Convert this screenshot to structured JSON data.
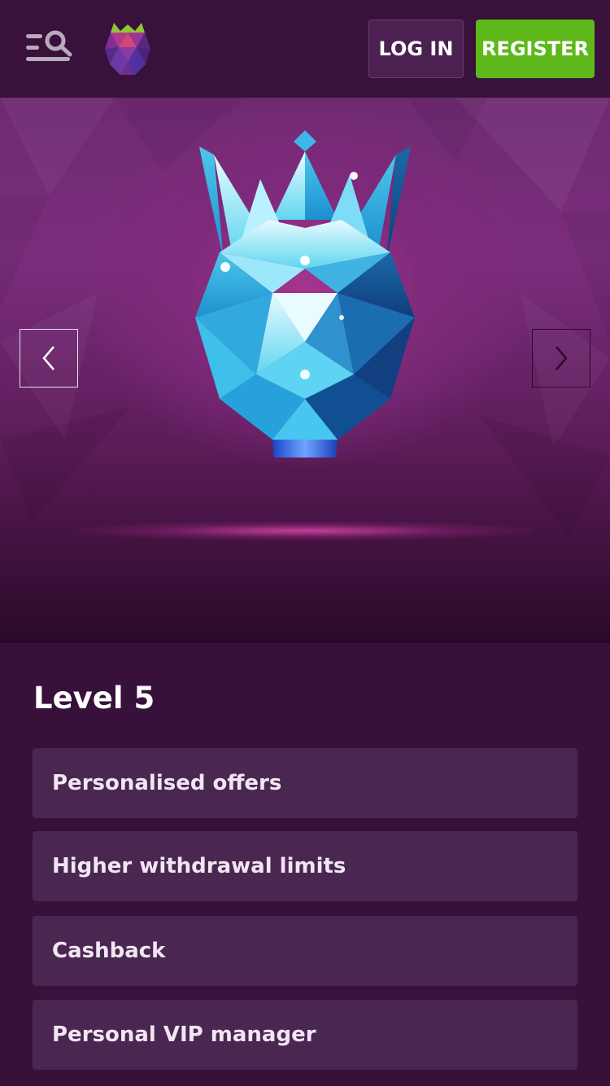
{
  "header": {
    "menu_icon": "menu-search-icon",
    "logo_icon": "raspberry-logo",
    "login_label": "LOG IN",
    "register_label": "REGISTER",
    "colors": {
      "background": "#38123b",
      "register": "#5fb81a",
      "login": "#4a2150"
    }
  },
  "hero": {
    "image": "diamond-crown-gem",
    "prev_icon": "chevron-left-icon",
    "next_icon": "chevron-right-icon"
  },
  "level": {
    "title": "Level 5",
    "perks": [
      {
        "label": "Personalised offers"
      },
      {
        "label": "Higher withdrawal limits"
      },
      {
        "label": "Cashback"
      },
      {
        "label": "Personal VIP manager"
      }
    ]
  }
}
